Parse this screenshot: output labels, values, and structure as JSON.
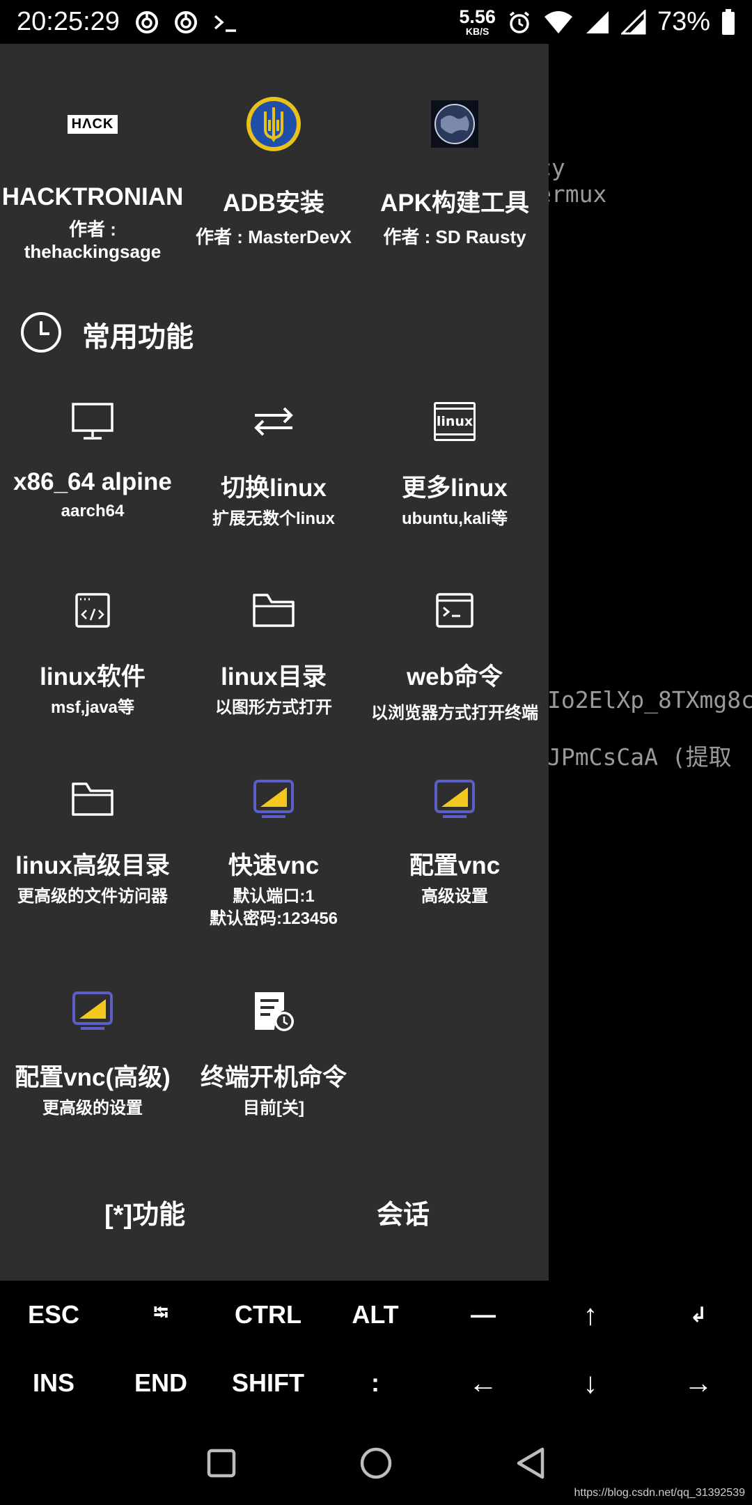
{
  "status_bar": {
    "time": "20:25:29",
    "speed_value": "5.56",
    "speed_unit": "KB/S",
    "battery": "73%",
    "icons": [
      "netease-music-icon",
      "netease-music-icon",
      "terminal-icon",
      "alarm-icon",
      "wifi-icon",
      "signal-icon",
      "signal-icon",
      "battery-icon"
    ]
  },
  "terminal": {
    "lines": [
      "cy",
      "ermux",
      "Io2ElXp_8TXmg8c",
      "JPmCsCaA  (提取"
    ]
  },
  "plugins": [
    {
      "title": "HACKTRONIAN",
      "sub1": "作者 :",
      "sub2": "thehackingsage",
      "logo_text": "HΛCK",
      "icon": "hack-logo"
    },
    {
      "title": "ADB安装",
      "sub1": "作者 : MasterDevX",
      "icon": "trident-emblem-icon"
    },
    {
      "title": "APK构建工具",
      "sub1": "作者 : SD Rausty",
      "icon": "earth-icon"
    }
  ],
  "section": {
    "label": "常用功能",
    "icon": "clock-icon"
  },
  "features": [
    {
      "title": "x86_64 alpine",
      "sub1": "aarch64",
      "icon": "monitor-icon"
    },
    {
      "title": "切换linux",
      "sub1": "扩展无数个linux",
      "icon": "swap-arrows-icon"
    },
    {
      "title": "更多linux",
      "sub1": "ubuntu,kali等",
      "icon": "linux-window-icon",
      "icon_text": "linux"
    },
    {
      "title": "linux软件",
      "sub1": "msf,java等",
      "icon": "code-window-icon"
    },
    {
      "title": "linux目录",
      "sub1": "以图形方式打开",
      "icon": "folder-icon"
    },
    {
      "title": "web命令",
      "sub1": "以浏览器方式打开终端",
      "icon": "terminal-window-icon"
    },
    {
      "title": "linux高级目录",
      "sub1": "更高级的文件访问器",
      "icon": "folder-icon"
    },
    {
      "title": "快速vnc",
      "sub1": "默认端口:1",
      "sub2": "默认密码:123456",
      "icon": "vnc-monitor-icon"
    },
    {
      "title": "配置vnc",
      "sub1": "高级设置",
      "icon": "vnc-monitor-icon"
    },
    {
      "title": "配置vnc(高级)",
      "sub1": "更高级的设置",
      "icon": "vnc-monitor-icon"
    },
    {
      "title": "终端开机命令",
      "sub1": "目前[关]",
      "icon": "document-clock-icon"
    }
  ],
  "drawer_buttons": {
    "functions": "[*]功能",
    "sessions": "会话"
  },
  "extra_keys": {
    "row1": [
      "ESC",
      "⭾",
      "CTRL",
      "ALT",
      "—",
      "↑",
      "↲"
    ],
    "row2": [
      "INS",
      "END",
      "SHIFT",
      ":",
      "←",
      "↓",
      "→"
    ]
  },
  "watermark": "https://blog.csdn.net/qq_31392539",
  "colors": {
    "drawer_bg": "#2e2e2e",
    "vnc_blue": "#5b5fc7",
    "vnc_yellow": "#f2c81e"
  }
}
